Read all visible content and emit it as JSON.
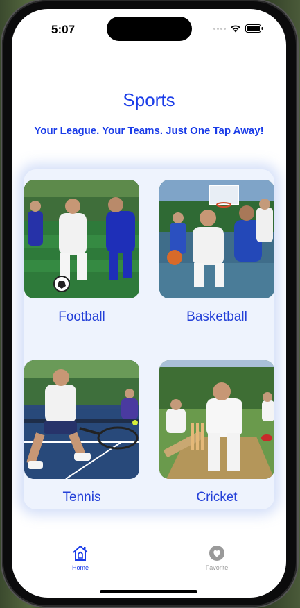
{
  "status_bar": {
    "time": "5:07"
  },
  "header": {
    "title": "Sports",
    "tagline": "Your League. Your Teams. Just One Tap Away!"
  },
  "sports": [
    {
      "label": "Football"
    },
    {
      "label": "Basketball"
    },
    {
      "label": "Tennis"
    },
    {
      "label": "Cricket"
    }
  ],
  "tabs": [
    {
      "label": "Home",
      "icon": "home-icon",
      "active": true
    },
    {
      "label": "Favorite",
      "icon": "heart-icon",
      "active": false
    }
  ],
  "colors": {
    "accent": "#1a3ce8",
    "inactive": "#9a9a9a",
    "card_bg": "#eef3fd"
  }
}
